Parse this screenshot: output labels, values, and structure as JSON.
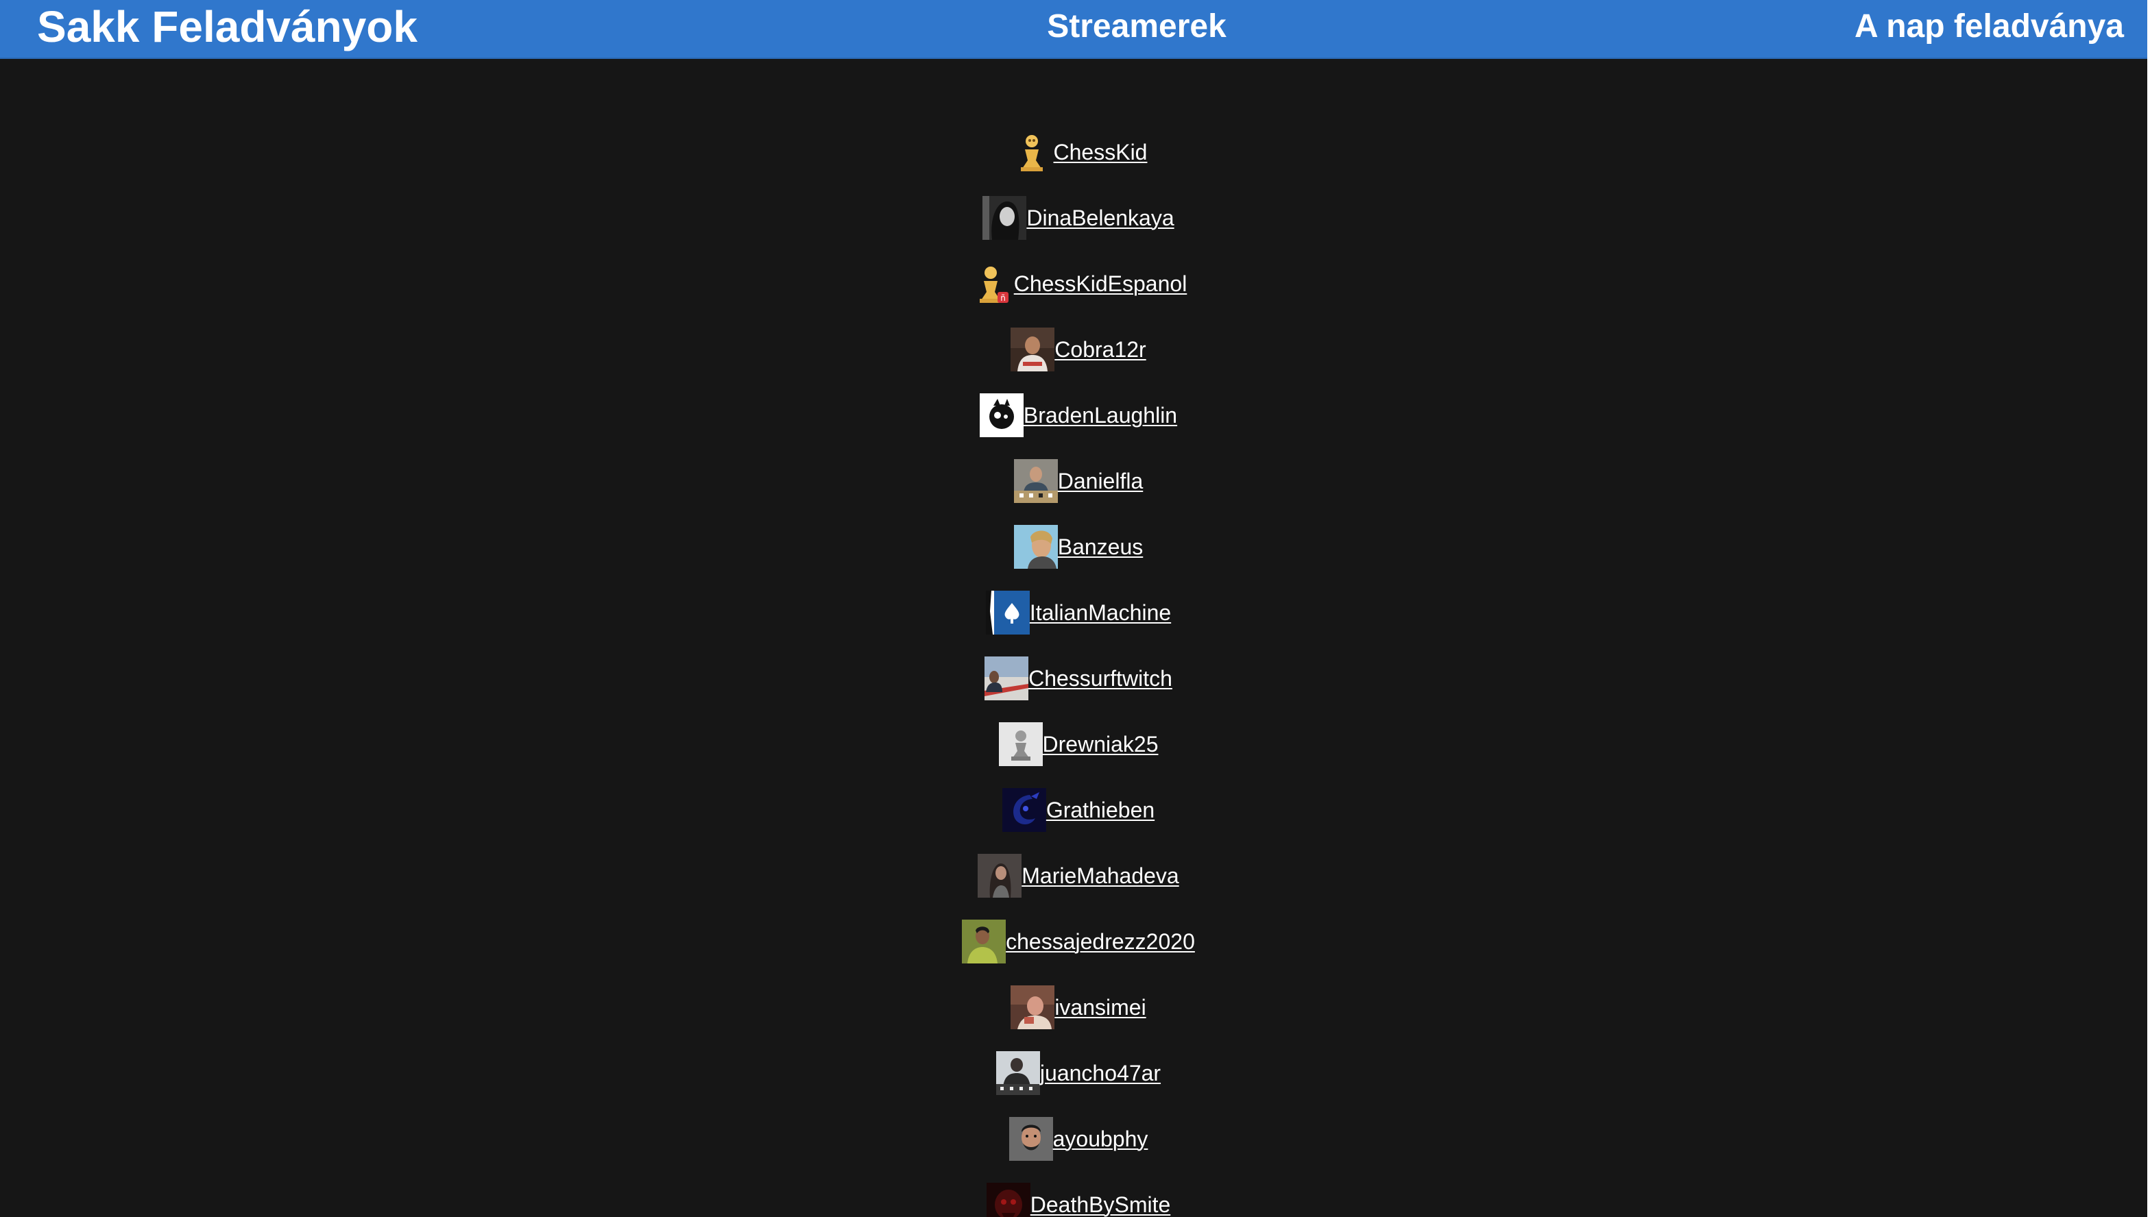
{
  "navbar": {
    "brand": "Sakk Feladványok",
    "streamers": "Streamerek",
    "daily_puzzle": "A nap feladványa",
    "color": "#3077cc"
  },
  "streamers": [
    {
      "name": "ChessKid",
      "avatar": "chesskid-pawn-avatar"
    },
    {
      "name": "DinaBelenkaya",
      "avatar": "dinabelenkaya-avatar"
    },
    {
      "name": "ChessKidEspanol",
      "avatar": "chesskid-espanol-avatar"
    },
    {
      "name": "Cobra12r",
      "avatar": "cobra12r-avatar"
    },
    {
      "name": "BradenLaughlin",
      "avatar": "bradenlaughlin-avatar"
    },
    {
      "name": "Danielfla",
      "avatar": "danielfla-avatar"
    },
    {
      "name": "Banzeus",
      "avatar": "banzeus-avatar"
    },
    {
      "name": "ItalianMachine",
      "avatar": "italianmachine-avatar"
    },
    {
      "name": "Chessurftwitch",
      "avatar": "chessurftwitch-avatar"
    },
    {
      "name": "Drewniak25",
      "avatar": "drewniak25-avatar"
    },
    {
      "name": "Grathieben",
      "avatar": "grathieben-avatar"
    },
    {
      "name": "MarieMahadeva",
      "avatar": "mariemahadeva-avatar"
    },
    {
      "name": "chessajedrezz2020",
      "avatar": "chessajedrezz2020-avatar"
    },
    {
      "name": "ivansimei",
      "avatar": "ivansimei-avatar"
    },
    {
      "name": "juancho47ar",
      "avatar": "juancho47ar-avatar"
    },
    {
      "name": "ayoubphy",
      "avatar": "ayoubphy-avatar"
    },
    {
      "name": "DeathBySmite",
      "avatar": "deathbysmite-avatar"
    }
  ]
}
